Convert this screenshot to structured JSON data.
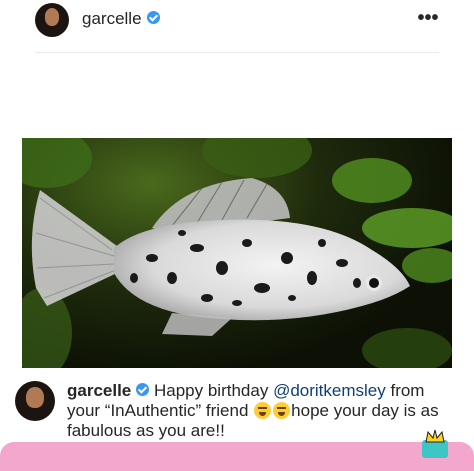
{
  "header": {
    "username": "garcelle",
    "more_label": "•••"
  },
  "post": {
    "image_icon": "fish-photo"
  },
  "caption": {
    "username": "garcelle",
    "text_before": " Happy birthday ",
    "mention": "@doritkemsley",
    "text_after_mention": " from your “InAuthentic” friend ",
    "emoji_1": "weary-face-emoji",
    "emoji_2": "joy-face-emoji",
    "text_end": "hope your day is as fabulous as you are!!"
  },
  "colors": {
    "verified": "#3897f0",
    "mention": "#0e3f7a",
    "bottom_bar": "#f4a7cc"
  }
}
